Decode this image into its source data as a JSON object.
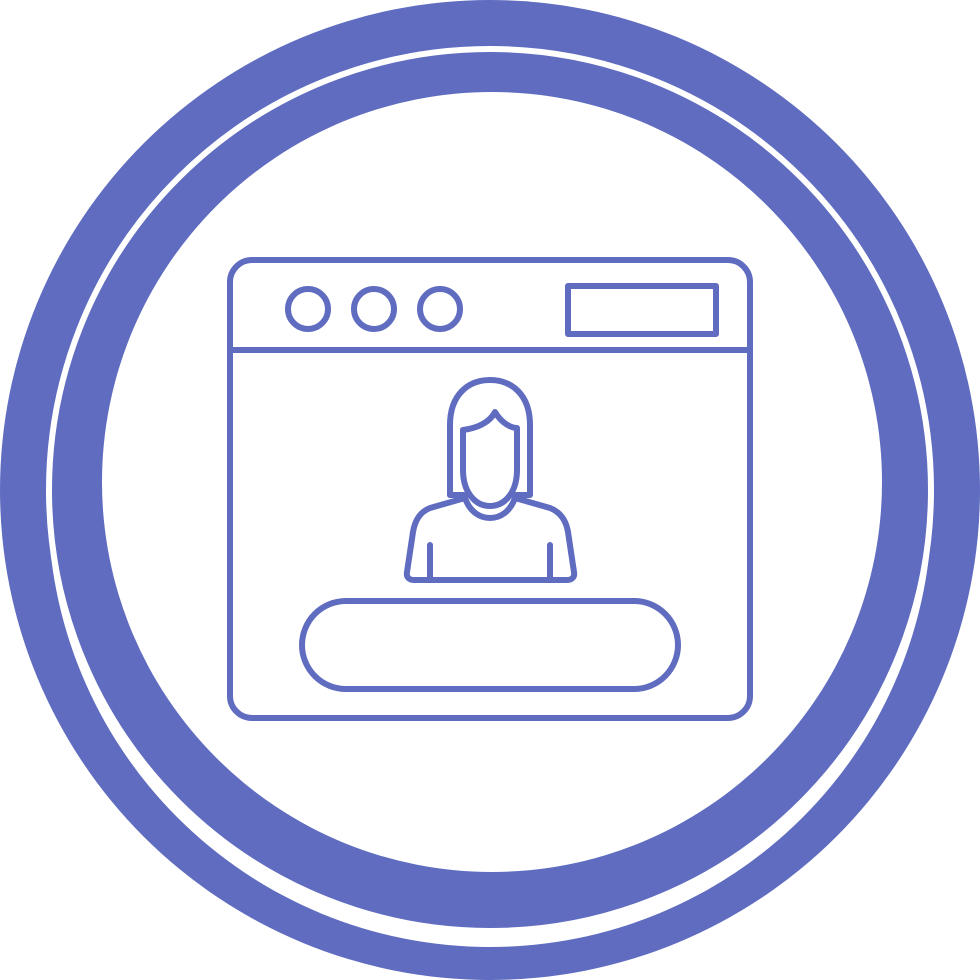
{
  "icon": {
    "name": "browser-window-user-profile-icon",
    "color": "#5f6cc0",
    "background": "#ffffff",
    "parts": {
      "outer_ring": "swirl-ring-icon",
      "window": "browser-window-icon",
      "traffic_lights": [
        "window-dot-icon",
        "window-dot-icon",
        "window-dot-icon"
      ],
      "address_bar": "address-bar-icon",
      "avatar": "female-user-avatar-icon",
      "action_bar": "pill-button-icon"
    }
  }
}
